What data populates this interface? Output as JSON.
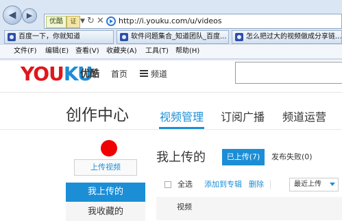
{
  "browser": {
    "address": {
      "brand_badge": "优酷",
      "cert_badge": "证",
      "url": "http://i.youku.com/u/videos"
    },
    "tabs": [
      {
        "label": "百度一下，你就知道"
      },
      {
        "label": "软件问题集合_知道团队_百度..."
      },
      {
        "label": "怎么把过大的视频做成分享链..."
      }
    ],
    "menu": [
      {
        "label": "文件(F)"
      },
      {
        "label": "编辑(E)"
      },
      {
        "label": "查看(V)"
      },
      {
        "label": "收藏夹(A)"
      },
      {
        "label": "工具(T)"
      },
      {
        "label": "帮助(H)"
      }
    ]
  },
  "site": {
    "logo_latin": {
      "part1": "YOU",
      "part2": "KU"
    },
    "logo_cn": "优酷",
    "nav": {
      "home": "首页",
      "channel": "频道"
    },
    "colors": {
      "brand_blue": "#1b8ed6",
      "brand_red": "#e0161b"
    }
  },
  "studio": {
    "title": "创作中心",
    "tabs": [
      {
        "label": "视频管理",
        "active": true
      },
      {
        "label": "订阅广播",
        "active": false
      },
      {
        "label": "频道运营",
        "active": false
      }
    ],
    "sidebar": {
      "upload_button": "上传视频",
      "items": [
        {
          "label": "我上传的",
          "active": true
        },
        {
          "label": "我收藏的",
          "active": false
        }
      ]
    },
    "main": {
      "heading": "我上传的",
      "filters": [
        {
          "label": "已上传(7)",
          "active": true
        },
        {
          "label": "发布失败(0)",
          "active": false
        }
      ],
      "toolbar": {
        "select_all": "全选",
        "add_to_album": "添加到专辑",
        "delete": "删除",
        "sort_selected": "最近上传"
      },
      "columns": {
        "video": "视频"
      }
    }
  }
}
